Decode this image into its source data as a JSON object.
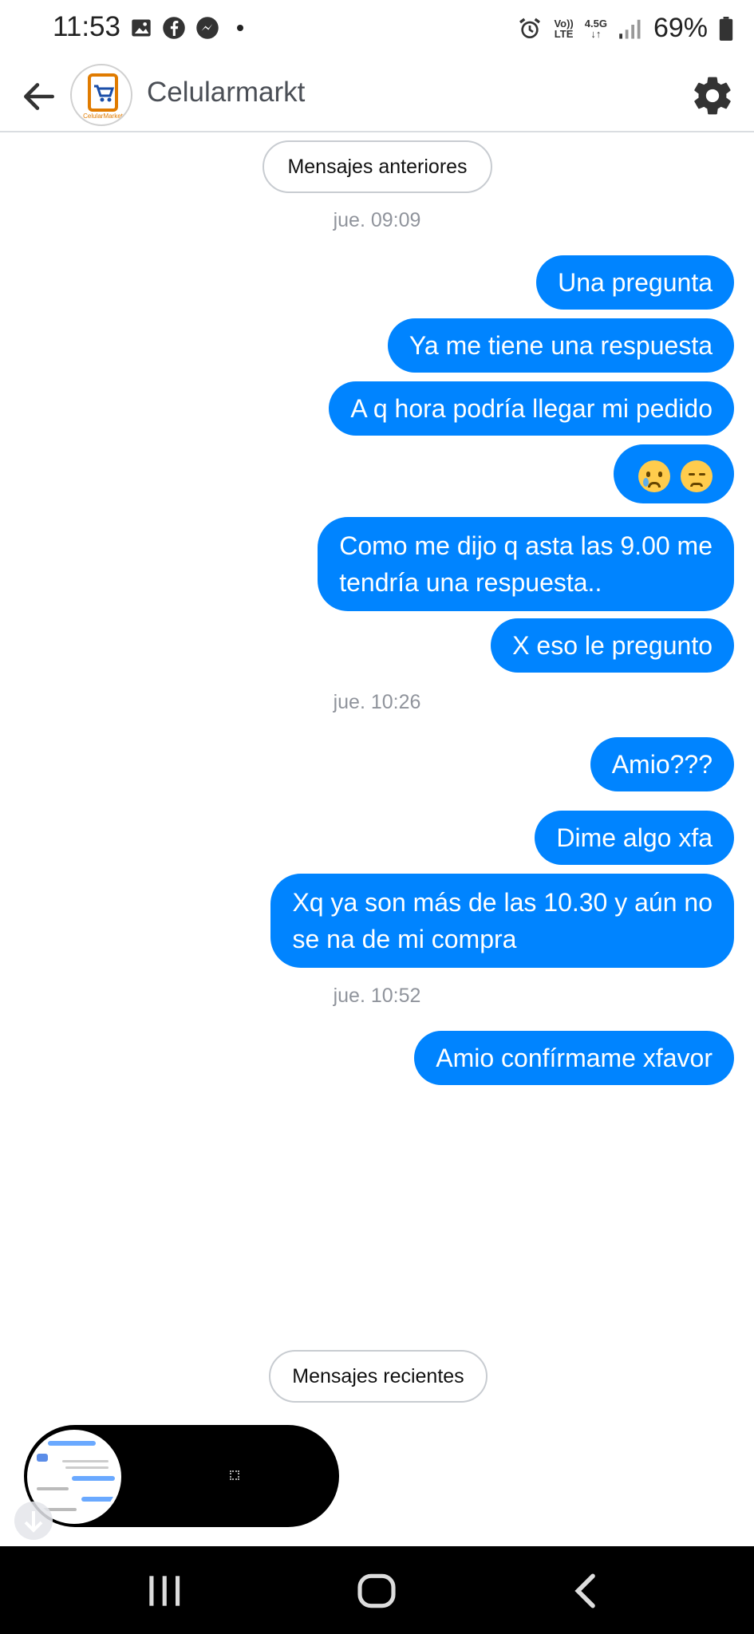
{
  "status_bar": {
    "time": "11:53",
    "battery": "69%",
    "network_top": "Vo))",
    "network_bottom": "LTE",
    "signal_label": "4.5G"
  },
  "header": {
    "page_name": "Celularmarkt",
    "avatar_label": "CelularMarket"
  },
  "chat": {
    "older_messages": "Mensajes anteriores",
    "recent_messages": "Mensajes recientes",
    "groups": [
      {
        "timestamp": "jue. 09:09"
      },
      {
        "timestamp": "jue. 10:26"
      },
      {
        "timestamp": "jue. 10:52"
      }
    ],
    "messages": [
      {
        "text": "Una pregunta"
      },
      {
        "text": "Ya me tiene una respuesta"
      },
      {
        "text": "A q hora podría llegar mi pedido"
      },
      {
        "text": "",
        "emoji": [
          "crying-face",
          "pensive-face"
        ]
      },
      {
        "line1": "Como me dijo q asta las 9.00 me",
        "line2": "tendría una respuesta.."
      },
      {
        "text": "X eso le pregunto"
      },
      {
        "text": "Amio???"
      },
      {
        "text": "Dime algo xfa"
      },
      {
        "line1": "Xq ya son más de las 10.30 y aún no",
        "line2": "se na de mi compra"
      },
      {
        "text": "Amio confírmame xfavor"
      }
    ]
  },
  "colors": {
    "bubble": "#0084ff",
    "timestamp": "#90949c",
    "navbar": "#000000"
  }
}
